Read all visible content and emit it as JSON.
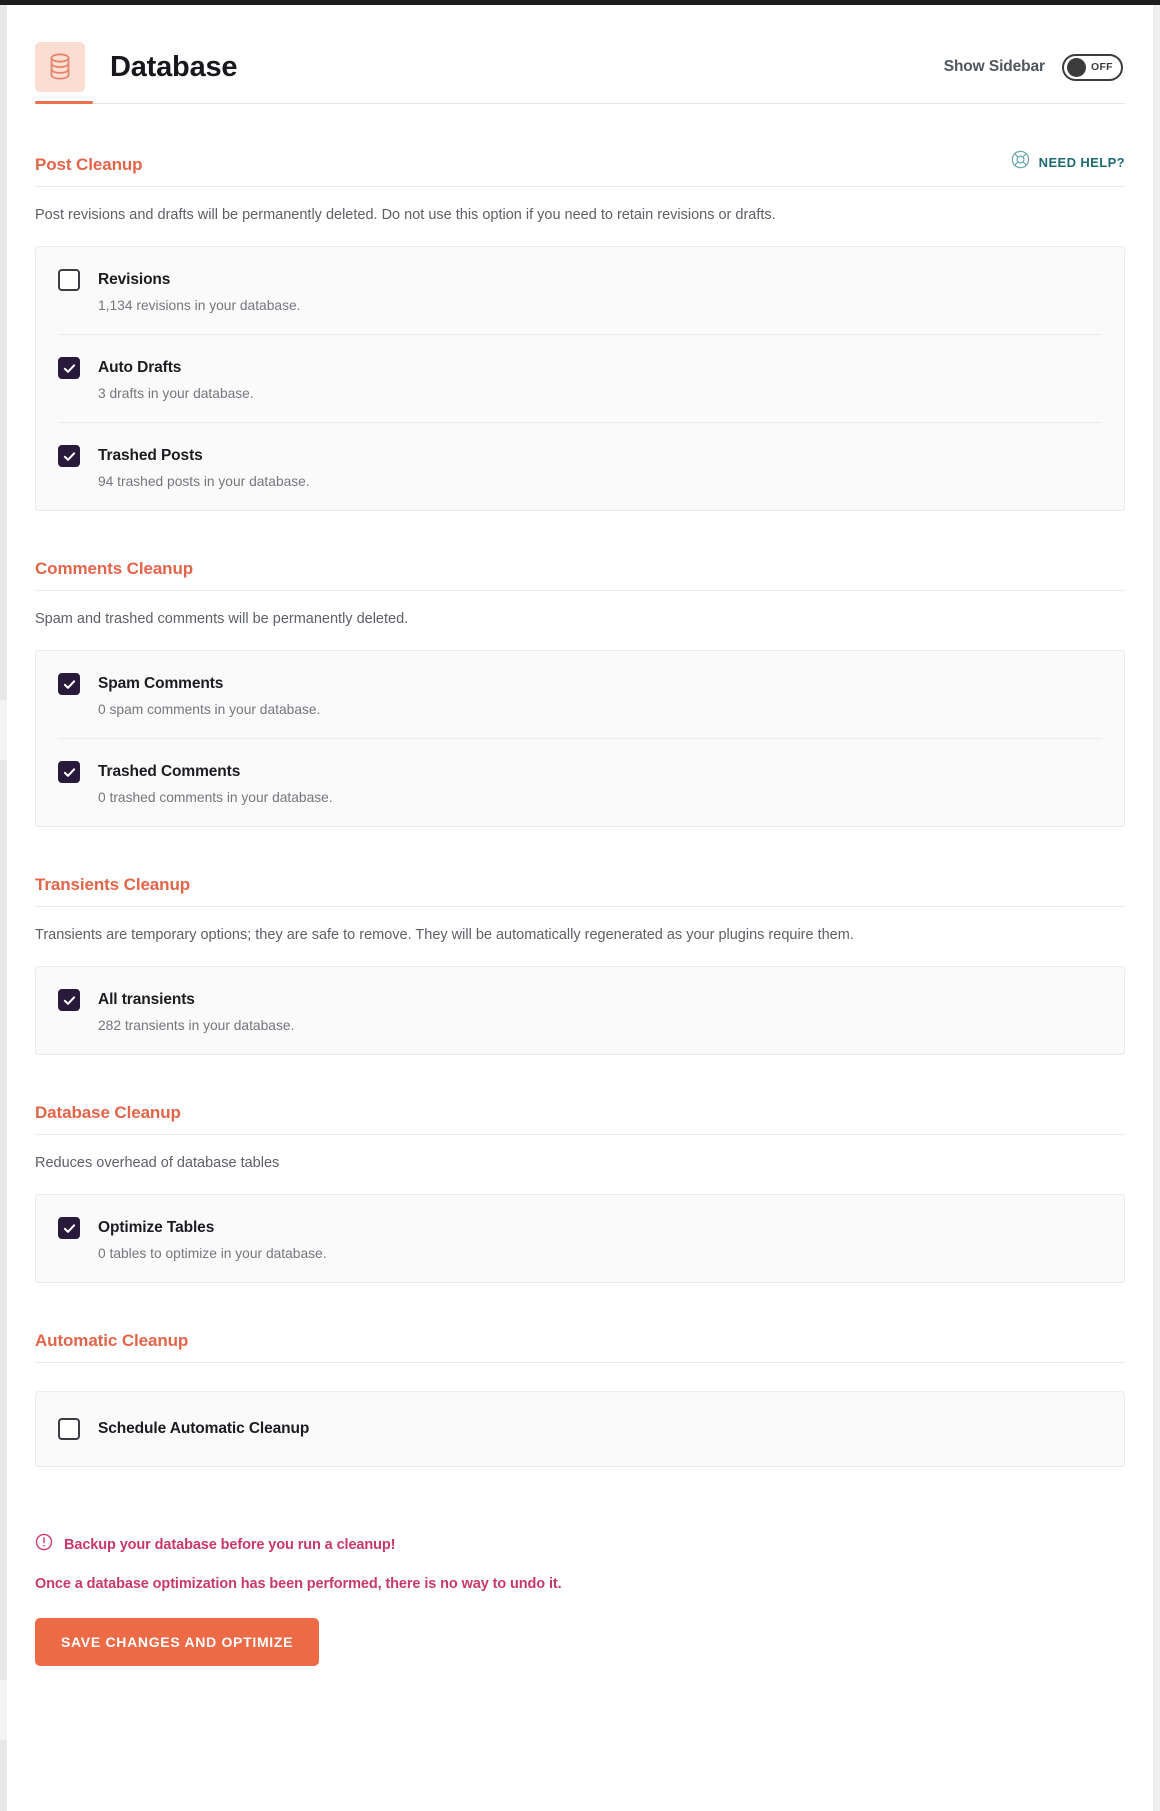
{
  "header": {
    "title": "Database",
    "brand_icon": "database-stack-icon",
    "sidebar_toggle_label": "Show Sidebar",
    "sidebar_toggle_state": "OFF",
    "accent_color": "#ec6f4c",
    "icon_bg_color": "#fbddd2"
  },
  "help": {
    "label": "NEED HELP?",
    "icon": "lifebuoy-icon",
    "color": "#1f6a72"
  },
  "sections": [
    {
      "title": "Post Cleanup",
      "description": "Post revisions and drafts will be permanently deleted. Do not use this option if you need to retain revisions or drafts.",
      "has_help": true,
      "options": [
        {
          "label": "Revisions",
          "sub": "1,134 revisions in your database.",
          "checked": false
        },
        {
          "label": "Auto Drafts",
          "sub": "3 drafts in your database.",
          "checked": true
        },
        {
          "label": "Trashed Posts",
          "sub": "94 trashed posts in your database.",
          "checked": true
        }
      ]
    },
    {
      "title": "Comments Cleanup",
      "description": "Spam and trashed comments will be permanently deleted.",
      "has_help": false,
      "options": [
        {
          "label": "Spam Comments",
          "sub": "0 spam comments in your database.",
          "checked": true
        },
        {
          "label": "Trashed Comments",
          "sub": "0 trashed comments in your database.",
          "checked": true
        }
      ]
    },
    {
      "title": "Transients Cleanup",
      "description": "Transients are temporary options; they are safe to remove. They will be automatically regenerated as your plugins require them.",
      "has_help": false,
      "options": [
        {
          "label": "All transients",
          "sub": "282 transients in your database.",
          "checked": true
        }
      ]
    },
    {
      "title": "Database Cleanup",
      "description": "Reduces overhead of database tables",
      "has_help": false,
      "options": [
        {
          "label": "Optimize Tables",
          "sub": "0 tables to optimize in your database.",
          "checked": true
        }
      ]
    },
    {
      "title": "Automatic Cleanup",
      "description": "",
      "has_help": false,
      "options": [
        {
          "label": "Schedule Automatic Cleanup",
          "sub": "",
          "checked": false
        }
      ]
    }
  ],
  "footer": {
    "warning_icon": "alert-circle-icon",
    "warning_text": "Backup your database before you run a cleanup!",
    "warning_note": "Once a database optimization has been performed, there is no way to undo it.",
    "warning_color": "#c9386b",
    "save_label": "SAVE CHANGES AND OPTIMIZE",
    "save_color": "#ec6a46"
  }
}
